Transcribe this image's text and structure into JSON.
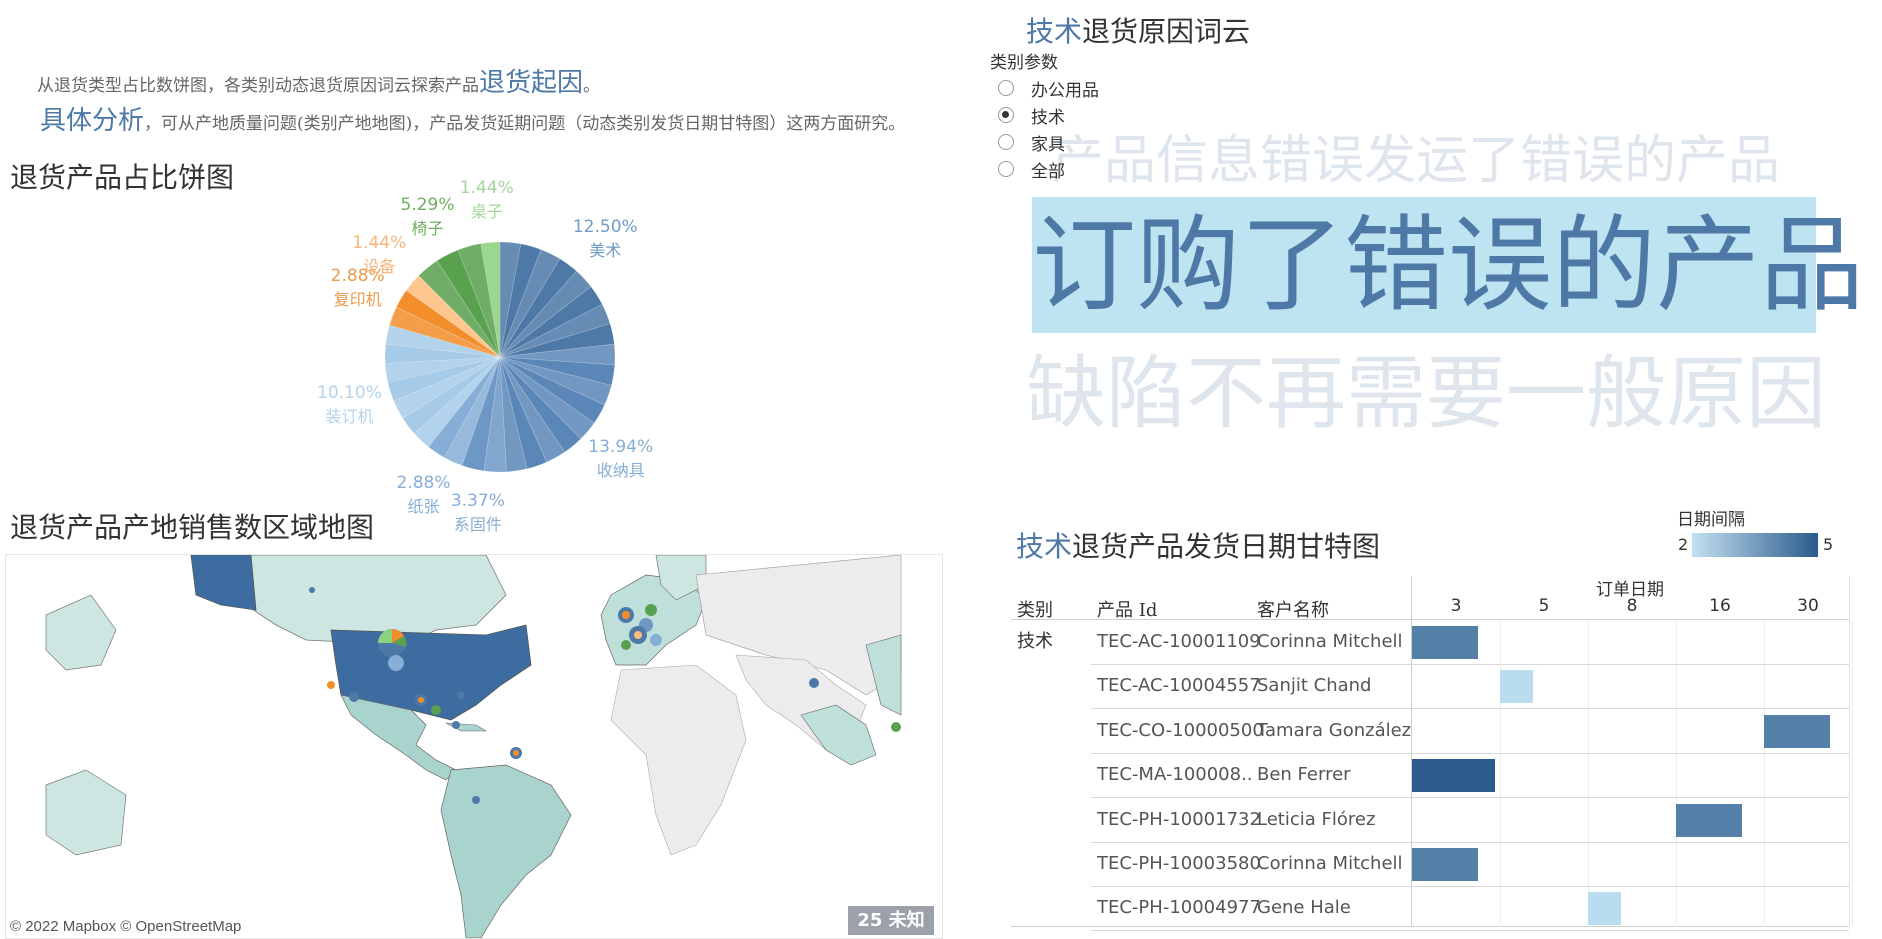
{
  "intro": {
    "line1_prefix": "从退货类型占比数饼图，各类别动态退货原因词云探索产品",
    "line1_highlight": "退货起因",
    "line1_suffix": "。",
    "line2_highlight": "具体分析",
    "line2_rest": "，可从产地质量问题(类别产地地图)，产品发货延期问题（动态类别发货日期甘特图）这两方面研究。"
  },
  "pie": {
    "title": "退货产品占比饼图",
    "slices": [
      {
        "name": "美术",
        "pct": "12.50%",
        "value": 12.5,
        "color": "#4e79a7",
        "labelColor": "#6f9cc9"
      },
      {
        "name": "收纳具",
        "pct": "13.94%",
        "value": 13.94,
        "color": "#5b87b8",
        "labelColor": "#86aed6"
      },
      {
        "name": "系固件",
        "pct": "3.37%",
        "value": 3.37,
        "color": "#6d98c6",
        "labelColor": "#86aed6"
      },
      {
        "name": "纸张",
        "pct": "2.88%",
        "value": 2.88,
        "color": "#86aed6",
        "labelColor": "#86aed6"
      },
      {
        "name": "装订机",
        "pct": "10.10%",
        "value": 10.1,
        "color": "#a6cbe8",
        "labelColor": "#b2d3ee"
      },
      {
        "name": "复印机",
        "pct": "2.88%",
        "value": 2.88,
        "color": "#f28e2b",
        "labelColor": "#ea9b4b"
      },
      {
        "name": "设备",
        "pct": "1.44%",
        "value": 1.44,
        "color": "#ffbe7d",
        "labelColor": "#f8b47a"
      },
      {
        "name": "椅子",
        "pct": "5.29%",
        "value": 5.29,
        "color": "#59a14f",
        "labelColor": "#6cae5f"
      },
      {
        "name": "桌子",
        "pct": "1.44%",
        "value": 1.44,
        "color": "#8cd17d",
        "labelColor": "#a3d69a"
      }
    ]
  },
  "cloud": {
    "title_highlight": "技术",
    "title_rest": "退货原因词云",
    "param_label": "类别参数",
    "options": [
      {
        "label": "办公用品",
        "selected": false
      },
      {
        "label": "技术",
        "selected": true
      },
      {
        "label": "家具",
        "selected": false
      },
      {
        "label": "全部",
        "selected": false
      }
    ],
    "word_top": "产品信息错误发运了错误的产品",
    "word_main": "订购了错误的产品",
    "word_bottom": "缺陷不再需要一般原因"
  },
  "map": {
    "title": "退货产品产地销售数区域地图",
    "credit": "© 2022 Mapbox © OpenStreetMap",
    "unknown_label": "25 未知"
  },
  "gantt": {
    "title_highlight": "技术",
    "title_rest": "退货产品发货日期甘特图",
    "legend_title": "日期间隔",
    "legend_min": "2",
    "legend_max": "5",
    "col_category": "类别",
    "col_product": "产品 Id",
    "col_customer": "客户名称",
    "col_date": "订单日期",
    "ticks": [
      "3",
      "5",
      "8",
      "16",
      "30"
    ],
    "category_value": "技术",
    "rows": [
      {
        "product": "TEC-AC-10001109",
        "customer": "Corinna Mitchell",
        "start": 0,
        "span": 1.5,
        "interval": 4
      },
      {
        "product": "TEC-AC-10004557",
        "customer": "Sanjit Chand",
        "start": 2,
        "span": 0.75,
        "interval": 2
      },
      {
        "product": "TEC-CO-10000500",
        "customer": "Tamara González",
        "start": 8,
        "span": 1.5,
        "interval": 4
      },
      {
        "product": "TEC-MA-100008..",
        "customer": "Ben Ferrer",
        "start": 0,
        "span": 1.875,
        "interval": 5
      },
      {
        "product": "TEC-PH-10001732",
        "customer": "Leticia Flórez",
        "start": 6,
        "span": 1.5,
        "interval": 4
      },
      {
        "product": "TEC-PH-10003580",
        "customer": "Corinna Mitchell",
        "start": 0,
        "span": 1.5,
        "interval": 4
      },
      {
        "product": "TEC-PH-10004977",
        "customer": "Gene Hale",
        "start": 4,
        "span": 0.75,
        "interval": 2
      }
    ],
    "colors": {
      "low": "#b9dcef",
      "high": "#2b5b8c"
    }
  }
}
